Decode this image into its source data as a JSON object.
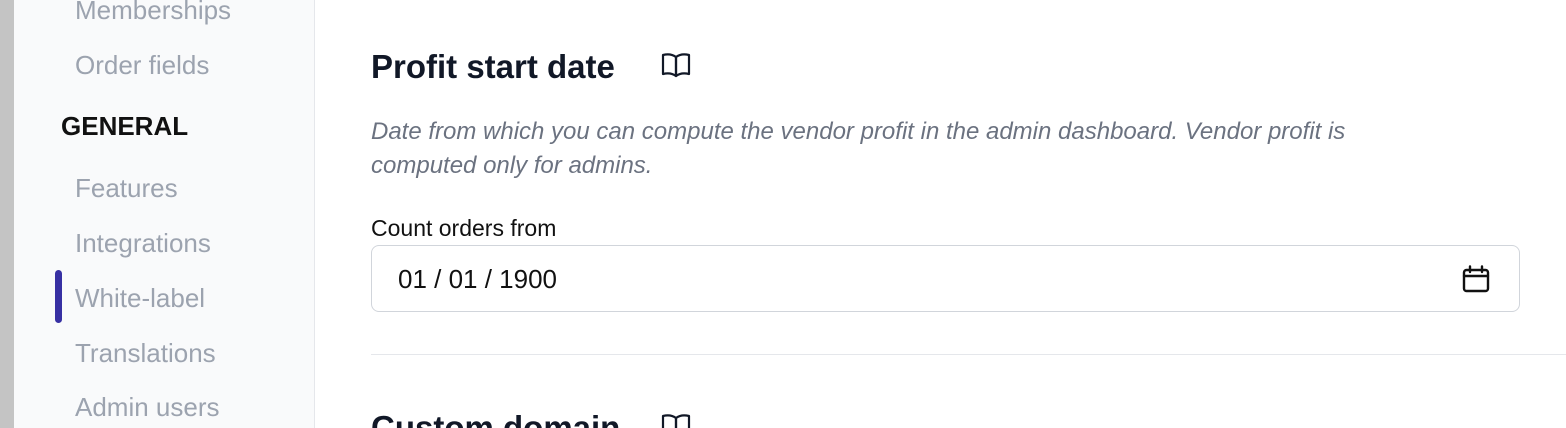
{
  "sidebar": {
    "items_top": [
      {
        "label": "Memberships"
      },
      {
        "label": "Order fields"
      }
    ],
    "section_label": "GENERAL",
    "items_general": [
      {
        "label": "Features"
      },
      {
        "label": "Integrations"
      },
      {
        "label": "White-label",
        "active": true
      },
      {
        "label": "Translations"
      },
      {
        "label": "Admin users"
      }
    ],
    "active_color": "#3730a3"
  },
  "profit_section": {
    "title": "Profit start date",
    "icon": "book-open-icon",
    "description": "Date from which you can compute the vendor profit in the admin dashboard. Vendor profit is computed only for admins.",
    "field_label": "Count orders from",
    "date_value": "01 / 01 / 1900",
    "date_icon": "calendar-icon"
  },
  "next_section": {
    "title": "Custom domain",
    "icon": "book-open-icon"
  }
}
